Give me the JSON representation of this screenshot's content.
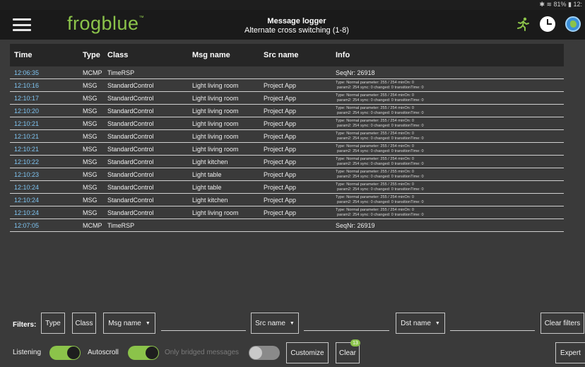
{
  "status": {
    "icons": "✱ ≋ 81% ▮ 12:"
  },
  "app": {
    "logo": "frogblue",
    "logo_tm": "™",
    "title": "Message logger",
    "subtitle": "Alternate cross switching (1-8)"
  },
  "table": {
    "columns": [
      "Time",
      "Type",
      "Class",
      "Msg name",
      "Src name",
      "Info"
    ],
    "rows": [
      {
        "time": "12:06:35",
        "type": "MCMP",
        "class": "TimeRSP",
        "msg": "",
        "src": "",
        "info": "SeqNr: 26918",
        "info2": ""
      },
      {
        "time": "12:10:16",
        "type": "MSG",
        "class": "StandardControl",
        "msg": "Light living room",
        "src": "Project App",
        "info": "Type: Normal parameter: 255 / 254 minOn: 0",
        "info2": "param2: 254 sync: 0 changed: 0 transitionTime: 0"
      },
      {
        "time": "12:10:17",
        "type": "MSG",
        "class": "StandardControl",
        "msg": "Light living room",
        "src": "Project App",
        "info": "Type: Normal parameter: 255 / 254 minOn: 0",
        "info2": "param2: 254 sync: 0 changed: 0 transitionTime: 0"
      },
      {
        "time": "12:10:20",
        "type": "MSG",
        "class": "StandardControl",
        "msg": "Light living room",
        "src": "Project App",
        "info": "Type: Normal parameter: 255 / 254 minOn: 0",
        "info2": "param2: 254 sync: 0 changed: 0 transitionTime: 0"
      },
      {
        "time": "12:10:21",
        "type": "MSG",
        "class": "StandardControl",
        "msg": "Light living room",
        "src": "Project App",
        "info": "Type: Normal parameter: 255 / 254 minOn: 0",
        "info2": "param2: 254 sync: 0 changed: 0 transitionTime: 0"
      },
      {
        "time": "12:10:21",
        "type": "MSG",
        "class": "StandardControl",
        "msg": "Light living room",
        "src": "Project App",
        "info": "Type: Normal parameter: 255 / 254 minOn: 0",
        "info2": "param2: 254 sync: 0 changed: 0 transitionTime: 0"
      },
      {
        "time": "12:10:21",
        "type": "MSG",
        "class": "StandardControl",
        "msg": "Light living room",
        "src": "Project App",
        "info": "Type: Normal parameter: 255 / 254 minOn: 0",
        "info2": "param2: 254 sync: 0 changed: 0 transitionTime: 0"
      },
      {
        "time": "12:10:22",
        "type": "MSG",
        "class": "StandardControl",
        "msg": "Light kitchen",
        "src": "Project App",
        "info": "Type: Normal parameter: 255 / 254 minOn: 0",
        "info2": "param2: 254 sync: 0 changed: 0 transitionTime: 0"
      },
      {
        "time": "12:10:23",
        "type": "MSG",
        "class": "StandardControl",
        "msg": "Light table",
        "src": "Project App",
        "info": "Type: Normal parameter: 255 / 255 minOn: 0",
        "info2": "param2: 254 sync: 0 changed: 0 transitionTime: 0"
      },
      {
        "time": "12:10:24",
        "type": "MSG",
        "class": "StandardControl",
        "msg": "Light table",
        "src": "Project App",
        "info": "Type: Normal parameter: 255 / 255 minOn: 0",
        "info2": "param2: 254 sync: 0 changed: 0 transitionTime: 0"
      },
      {
        "time": "12:10:24",
        "type": "MSG",
        "class": "StandardControl",
        "msg": "Light kitchen",
        "src": "Project App",
        "info": "Type: Normal parameter: 255 / 254 minOn: 0",
        "info2": "param2: 254 sync: 0 changed: 0 transitionTime: 0"
      },
      {
        "time": "12:10:24",
        "type": "MSG",
        "class": "StandardControl",
        "msg": "Light living room",
        "src": "Project App",
        "info": "Type: Normal parameter: 255 / 254 minOn: 0",
        "info2": "param2: 254 sync: 0 changed: 0 transitionTime: 0"
      },
      {
        "time": "12:07:05",
        "type": "MCMP",
        "class": "TimeRSP",
        "msg": "",
        "src": "",
        "info": "SeqNr: 26919",
        "info2": ""
      }
    ]
  },
  "filters": {
    "label": "Filters:",
    "type": "Type",
    "class": "Class",
    "msg_name": "Msg name",
    "src_name": "Src name",
    "dst_name": "Dst name",
    "clear_filters": "Clear filters"
  },
  "bottom": {
    "listening": "Listening",
    "autoscroll": "Autoscroll",
    "only_bridged": "Only bridged messages",
    "customize": "Customize",
    "clear": "Clear",
    "clear_badge": "13",
    "expert": "Expert",
    "listening_on": true,
    "autoscroll_on": true,
    "bridged_on": false
  },
  "colors": {
    "accent": "#8bc34a",
    "time": "#7ec3f0",
    "background": "#3a3a3a",
    "header": "#1a1a1a"
  }
}
